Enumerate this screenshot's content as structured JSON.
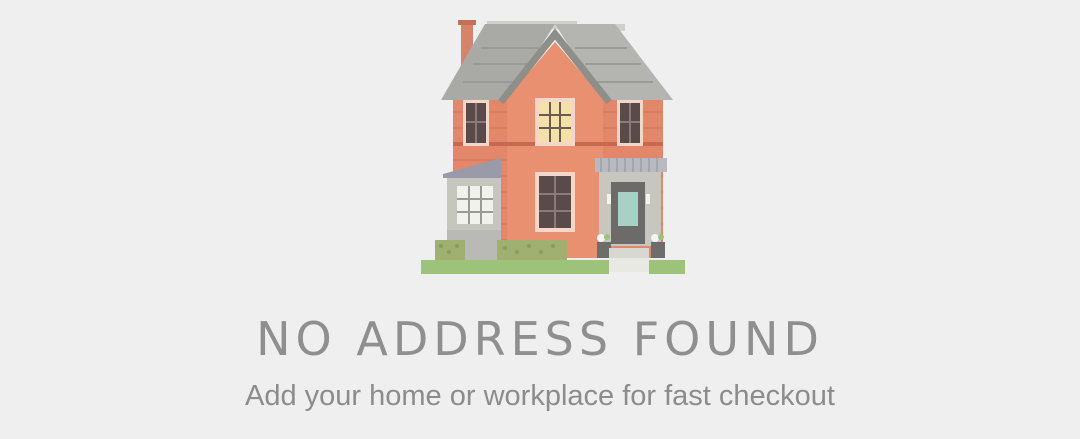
{
  "empty_state": {
    "illustration": "house-illustration",
    "title": "NO ADDRESS FOUND",
    "subtitle": "Add your home or workplace for fast checkout"
  },
  "colors": {
    "background": "#efefef",
    "text": "#8f8f8f",
    "brick": "#e2876a",
    "roof": "#a9a9a5",
    "grass": "#9dc27a"
  }
}
